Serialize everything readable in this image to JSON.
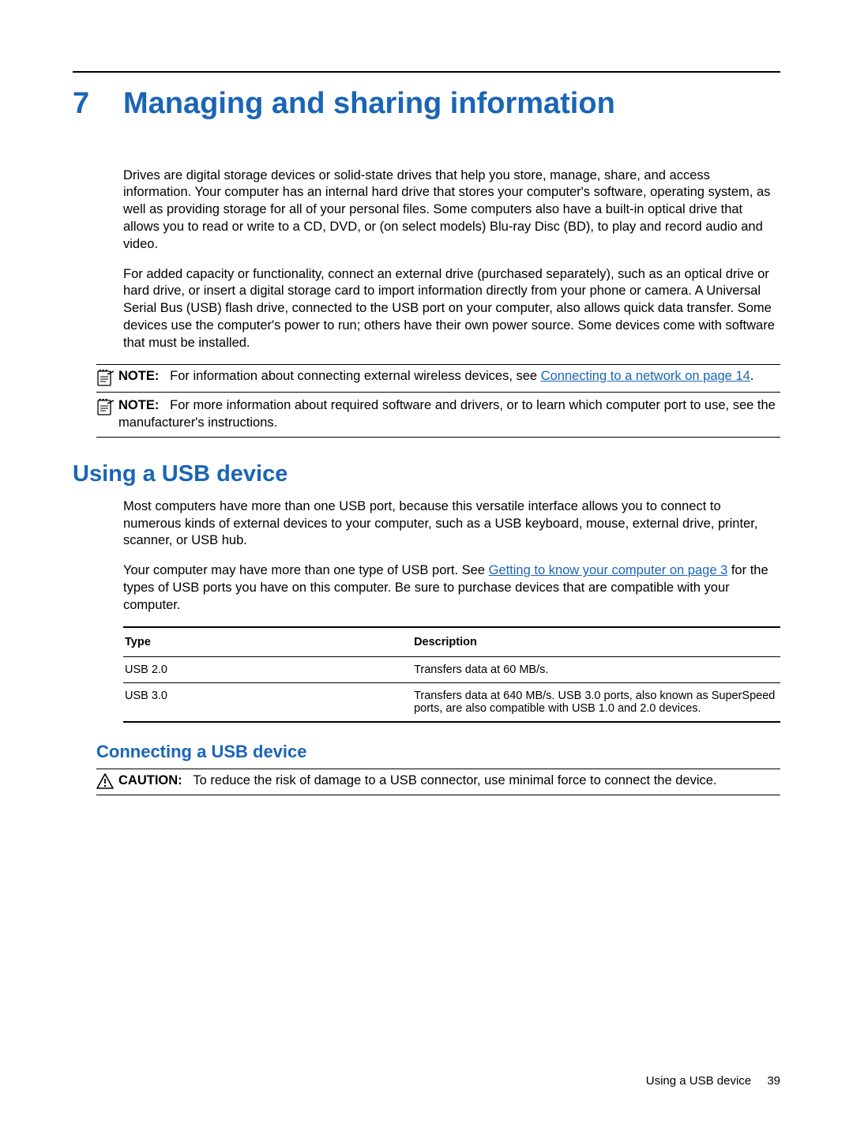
{
  "chapter": {
    "number": "7",
    "title": "Managing and sharing information"
  },
  "intro": {
    "p1": "Drives are digital storage devices or solid-state drives that help you store, manage, share, and access information. Your computer has an internal hard drive that stores your computer's software, operating system, as well as providing storage for all of your personal files. Some computers also have a built-in optical drive that allows you to read or write to a CD, DVD, or (on select models) Blu-ray Disc (BD), to play and record audio and video.",
    "p2": "For added capacity or functionality, connect an external drive (purchased separately), such as an optical drive or hard drive, or insert a digital storage card to import information directly from your phone or camera. A Universal Serial Bus (USB) flash drive, connected to the USB port on your computer, also allows quick data transfer. Some devices use the computer's power to run; others have their own power source. Some devices come with software that must be installed."
  },
  "notes": {
    "label": "NOTE:",
    "n1_pre": "For information about connecting external wireless devices, see ",
    "n1_link": "Connecting to a network on page 14",
    "n1_post": ".",
    "n2": "For more information about required software and drivers, or to learn which computer port to use, see the manufacturer's instructions."
  },
  "section_usb": {
    "heading": "Using a USB device",
    "p1": "Most computers have more than one USB port, because this versatile interface allows you to connect to numerous kinds of external devices to your computer, such as a USB keyboard, mouse, external drive, printer, scanner, or USB hub.",
    "p2_pre": "Your computer may have more than one type of USB port. See ",
    "p2_link": "Getting to know your computer on page 3",
    "p2_post": " for the types of USB ports you have on this computer. Be sure to purchase devices that are compatible with your computer."
  },
  "usb_table": {
    "headers": {
      "type": "Type",
      "desc": "Description"
    },
    "rows": [
      {
        "type": "USB 2.0",
        "desc": "Transfers data at 60 MB/s."
      },
      {
        "type": "USB 3.0",
        "desc": "Transfers data at 640 MB/s. USB 3.0 ports, also known as SuperSpeed ports, are also compatible with USB 1.0 and 2.0 devices."
      }
    ]
  },
  "subsection_connect": {
    "heading": "Connecting a USB device",
    "caution_label": "CAUTION:",
    "caution_text": "To reduce the risk of damage to a USB connector, use minimal force to connect the device."
  },
  "footer": {
    "text": "Using a USB device",
    "page": "39"
  }
}
